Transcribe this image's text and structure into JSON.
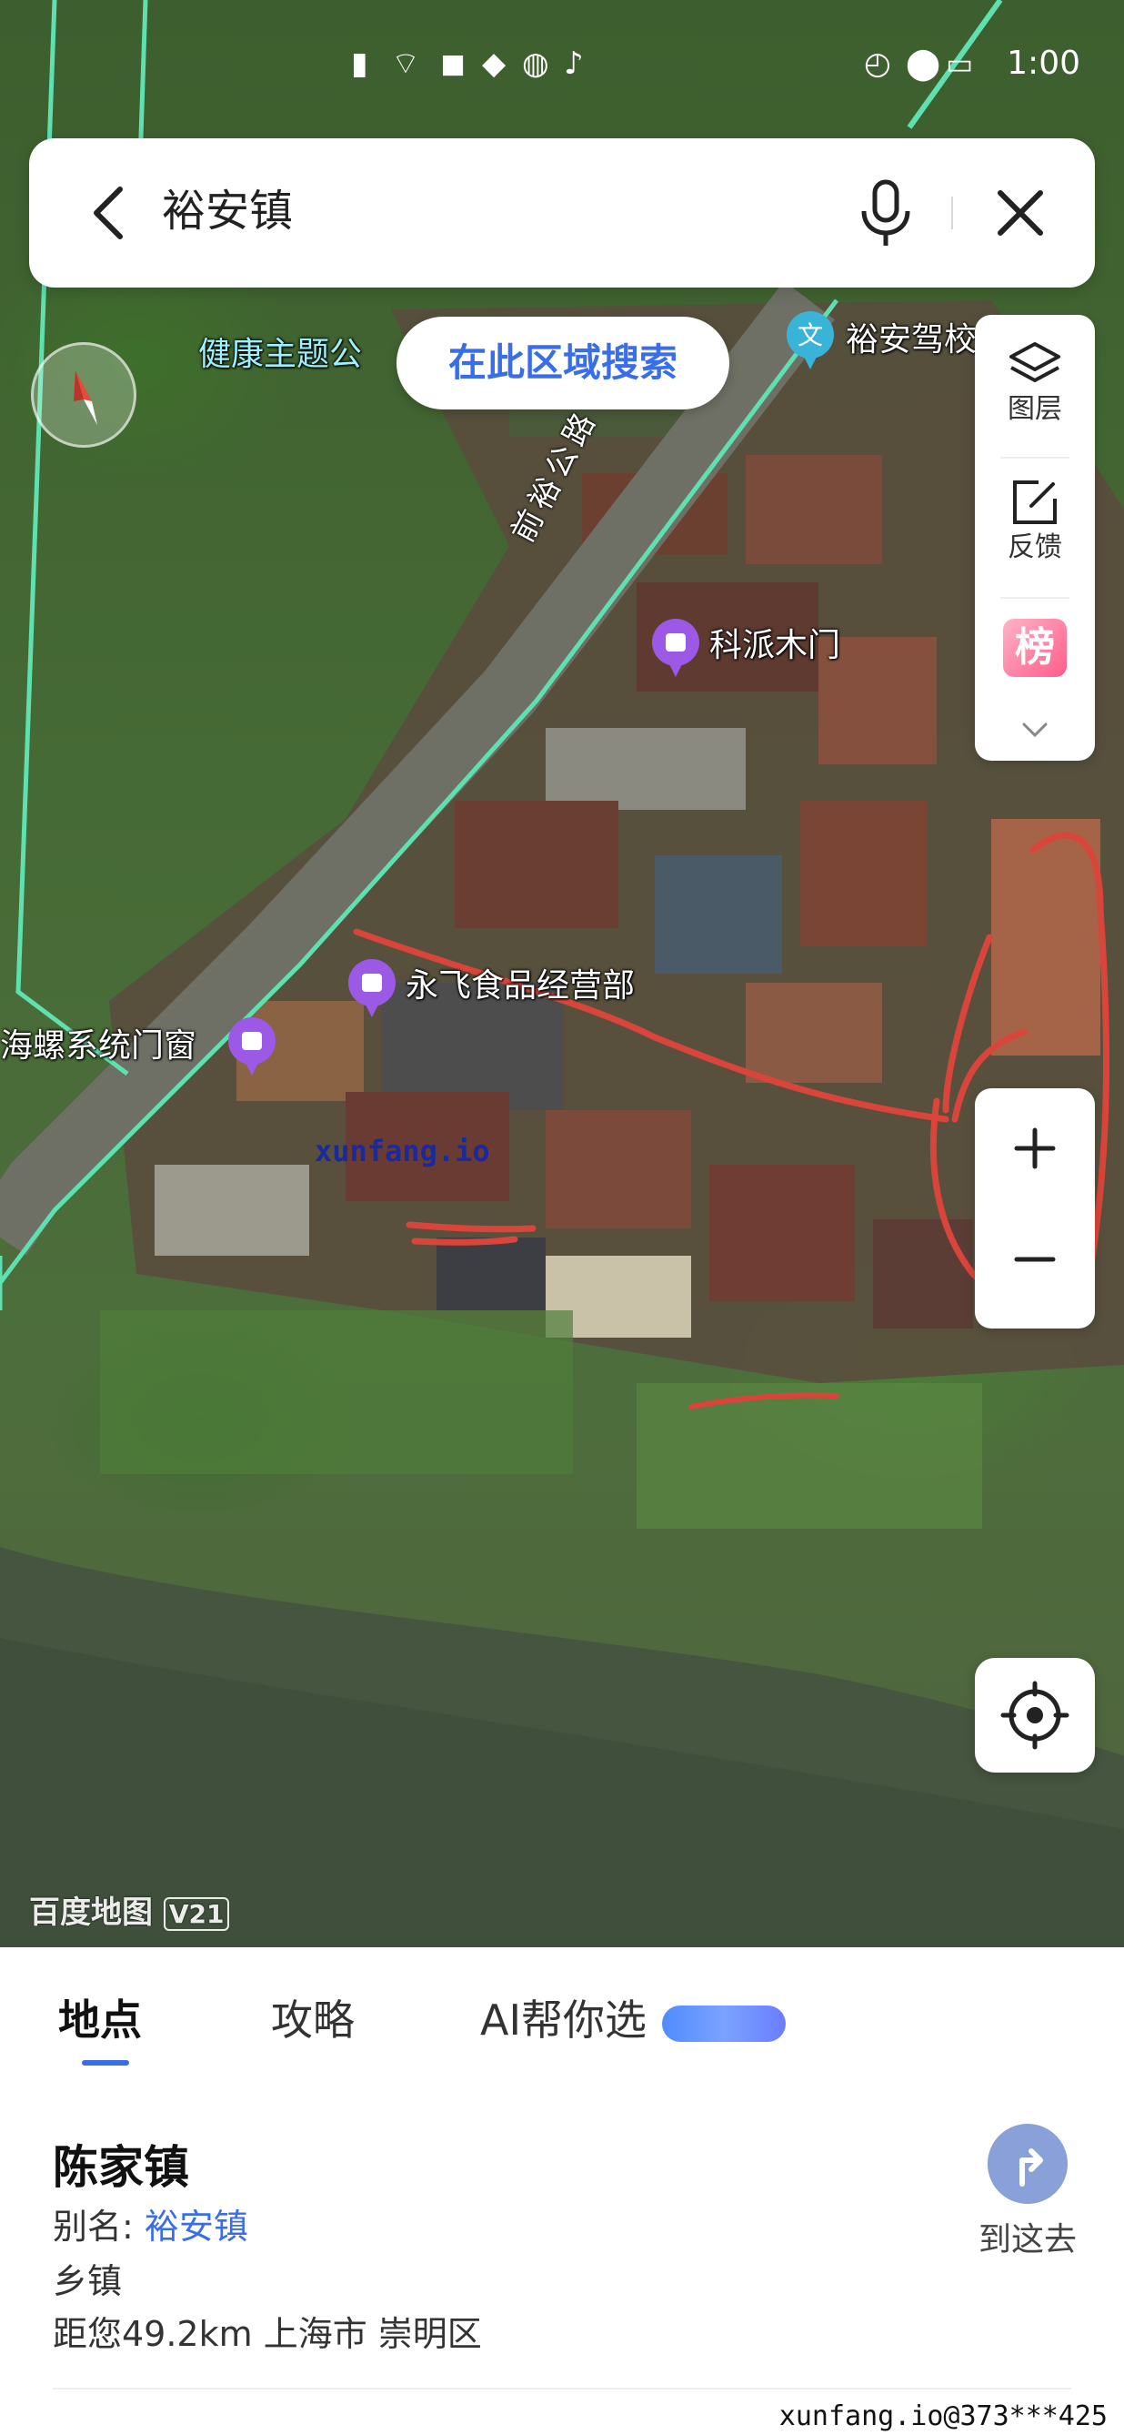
{
  "status_bar": {
    "time": "1:00",
    "icons": [
      "notification-icon",
      "wifi-icon",
      "app-icon",
      "qq-icon",
      "browser-icon",
      "tiktok-icon",
      "alarm-icon",
      "location-icon",
      "battery-icon"
    ]
  },
  "search": {
    "query": "裕安镇"
  },
  "map": {
    "search_area_label": "在此区域搜索",
    "labels": {
      "park": "健康主题公",
      "driving_school": "裕安驾校",
      "road": "前裕公路",
      "poi_1": "科派木门",
      "poi_2": "永飞食品经营部",
      "poi_3": "海螺系统门窗"
    },
    "map_watermark": "xunfang.io",
    "brand": "百度地图",
    "brand_version": "V21"
  },
  "tools": {
    "layers_label": "图层",
    "feedback_label": "反馈",
    "rank_char": "榜"
  },
  "sheet": {
    "tabs": [
      "地点",
      "攻略",
      "AI帮你选"
    ],
    "place_name": "陈家镇",
    "alias_label": "别名:",
    "alias_value": "裕安镇",
    "category": "乡镇",
    "distance": "距您49.2km 上海市 崇明区",
    "goto_label": "到这去",
    "bottom_watermark": "xunfang.io@373***425"
  },
  "colors": {
    "accent": "#3a6ee8",
    "road_line": "#5fe0b0",
    "annotation_red": "#d9453a",
    "poi_purple": "#9b59e6"
  }
}
